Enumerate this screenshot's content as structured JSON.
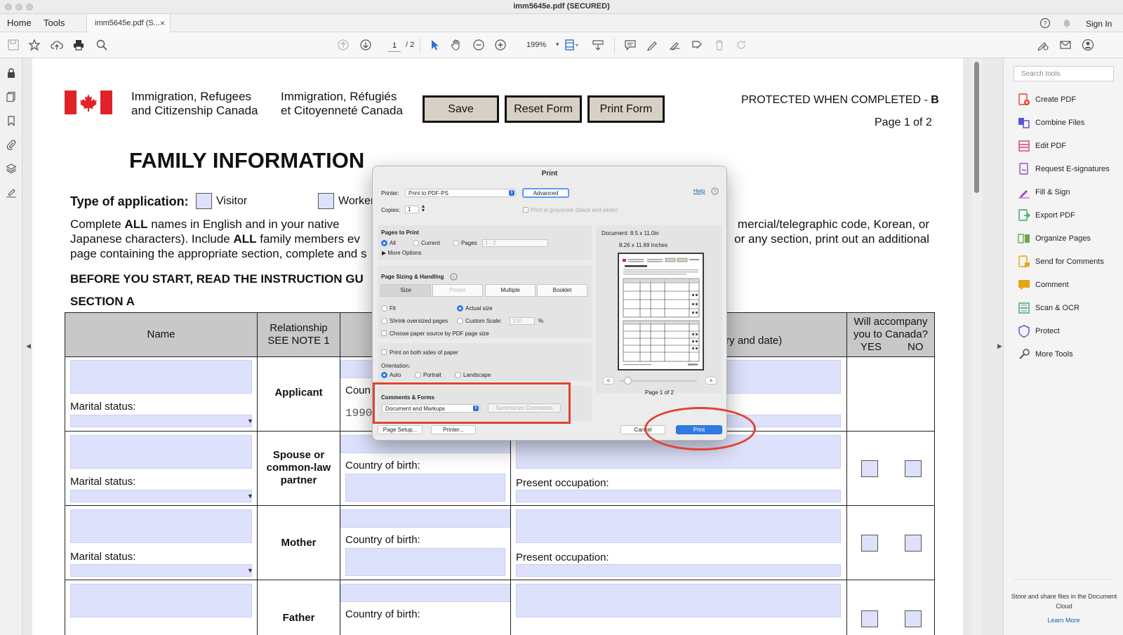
{
  "window": {
    "title": "imm5645e.pdf (SECURED)"
  },
  "menu": {
    "home": "Home",
    "tools": "Tools",
    "tab_label": "imm5645e.pdf (S...",
    "tab_close": "×",
    "sign_in": "Sign In"
  },
  "toolbar": {
    "page_current": "1",
    "page_total": "/  2",
    "zoom": "199%"
  },
  "tools_pane": {
    "search_placeholder": "Search tools",
    "items": [
      {
        "label": "Create PDF",
        "color": "#e0432f"
      },
      {
        "label": "Combine Files",
        "color": "#5757d6"
      },
      {
        "label": "Edit PDF",
        "color": "#d94874"
      },
      {
        "label": "Request E-signatures",
        "color": "#9b46c6"
      },
      {
        "label": "Fill & Sign",
        "color": "#9b46c6"
      },
      {
        "label": "Export PDF",
        "color": "#3aa36b"
      },
      {
        "label": "Organize Pages",
        "color": "#6aa84f"
      },
      {
        "label": "Send for Comments",
        "color": "#e8a317"
      },
      {
        "label": "Comment",
        "color": "#e8a317"
      },
      {
        "label": "Scan & OCR",
        "color": "#3aa36b"
      },
      {
        "label": "Protect",
        "color": "#5757d6"
      },
      {
        "label": "More Tools",
        "color": "#555555"
      }
    ],
    "cloud_note": "Store and share files in the Document Cloud",
    "learn_more": "Learn More"
  },
  "form": {
    "dept_en_1": "Immigration, Refugees",
    "dept_en_2": "and Citizenship Canada",
    "dept_fr_1": "Immigration, Réfugiés",
    "dept_fr_2": "et Citoyenneté Canada",
    "save": "Save",
    "reset": "Reset Form",
    "print": "Print Form",
    "protected_prefix": "PROTECTED WHEN COMPLETED - ",
    "protected_letter": "B",
    "page_of": "Page 1 of 2",
    "title": "FAMILY INFORMATION",
    "app_type_label": "Type of application:",
    "opt_visitor": "Visitor",
    "opt_worker": "Worker",
    "para_1a": "Complete ",
    "para_1b": "ALL",
    "para_1c": " names in English and in your native",
    "para_1d": "mercial/telegraphic code, Korean, or",
    "para_2a": "Japanese characters). Include ",
    "para_2b": "ALL",
    "para_2c": " family members ev",
    "para_2d": "or any section, print out an additional",
    "para_3": "page containing the appropriate section, complete and s",
    "before": "BEFORE YOU START, READ THE INSTRUCTION GU",
    "section_a": "SECTION A",
    "col_name": "Name",
    "col_rel_1": "Relationship",
    "col_rel_2": "SEE NOTE 1",
    "col_addr": "try and date)",
    "col_will_1": "Will accompany",
    "col_will_2": "you to Canada?",
    "col_yes": "YES",
    "col_no": "NO",
    "marital": "Marital status:",
    "country_birth": "Country of birth:",
    "country_trunc": "Coun",
    "present_occ": "Present occupation:",
    "ymd_prefix": "1990",
    "rel_applicant": "Applicant",
    "rel_spouse_1": "Spouse or",
    "rel_spouse_2": "common-law",
    "rel_spouse_3": "partner",
    "rel_mother": "Mother",
    "rel_father": "Father"
  },
  "print_dialog": {
    "title": "Print",
    "printer_label": "Printer:",
    "printer_value": "Print to PDF-PS",
    "advanced": "Advanced",
    "help": "Help",
    "copies_label": "Copies:",
    "copies_value": "1",
    "grayscale": "Print in grayscale (black and white)",
    "pages_to_print": "Pages to Print",
    "opt_all": "All",
    "opt_current": "Current",
    "opt_pages": "Pages",
    "pages_range": "1 - 2",
    "more_options": "More Options",
    "sizing": "Page Sizing & Handling",
    "seg_size": "Size",
    "seg_poster": "Poster",
    "seg_multiple": "Multiple",
    "seg_booklet": "Booklet",
    "fit": "Fit",
    "actual_size": "Actual size",
    "shrink": "Shrink oversized pages",
    "custom_scale": "Custom Scale:",
    "scale_value": "100",
    "percent": "%",
    "paper_source": "Choose paper source by PDF page size",
    "both_sides": "Print on both sides of paper",
    "orientation": "Orientation:",
    "opt_auto": "Auto",
    "opt_portrait": "Portrait",
    "opt_landscape": "Landscape",
    "comments_forms": "Comments & Forms",
    "comments_value": "Document and Markups",
    "summarize": "Summarize Comments",
    "page_setup": "Page Setup...",
    "printer_btn": "Printer...",
    "cancel": "Cancel",
    "print_btn": "Print",
    "doc_size": "Document: 8.5 x 11.0in",
    "paper_size": "8.26 x 11.69 Inches",
    "prev": "<",
    "next": ">",
    "preview_page": "Page 1 of 2"
  }
}
